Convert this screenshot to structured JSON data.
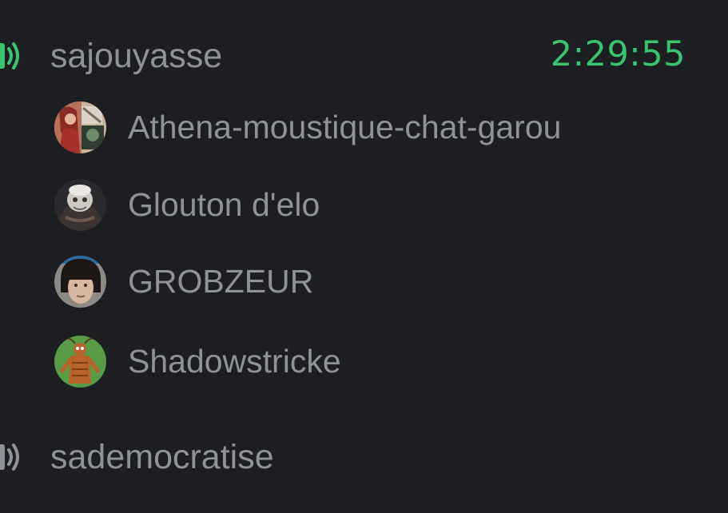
{
  "colors": {
    "background": "#1d1e22",
    "text": "#8f929b",
    "active_green": "#3ac470",
    "inactive_icon": "#8f929b"
  },
  "channels": [
    {
      "name": "sajouyasse",
      "timer": "2:29:55",
      "icon": "speaker-icon",
      "active": true,
      "members": [
        {
          "name": "Athena-moustique-chat-garou",
          "avatar": "avatar-icon"
        },
        {
          "name": "Glouton d'elo",
          "avatar": "avatar-icon"
        },
        {
          "name": "GROBZEUR",
          "avatar": "avatar-icon"
        },
        {
          "name": "Shadowstricke",
          "avatar": "avatar-icon"
        }
      ]
    },
    {
      "name": "sademocratise",
      "icon": "speaker-icon",
      "active": false
    }
  ]
}
